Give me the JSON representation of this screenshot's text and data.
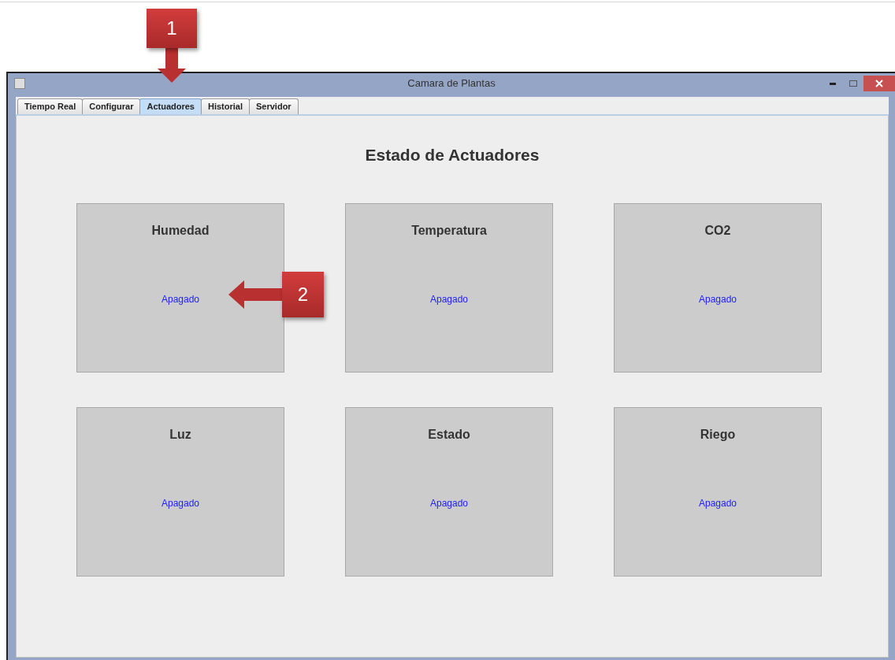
{
  "window": {
    "title": "Camara de Plantas"
  },
  "tabs": [
    {
      "label": "Tiempo Real",
      "selected": false
    },
    {
      "label": "Configurar",
      "selected": false
    },
    {
      "label": "Actuadores",
      "selected": true
    },
    {
      "label": "Historial",
      "selected": false
    },
    {
      "label": "Servidor",
      "selected": false
    }
  ],
  "heading": "Estado de Actuadores",
  "panels": [
    {
      "title": "Humedad",
      "status": "Apagado"
    },
    {
      "title": "Temperatura",
      "status": "Apagado"
    },
    {
      "title": "CO2",
      "status": "Apagado"
    },
    {
      "title": "Luz",
      "status": "Apagado"
    },
    {
      "title": "Estado",
      "status": "Apagado"
    },
    {
      "title": "Riego",
      "status": "Apagado"
    }
  ],
  "callouts": [
    {
      "label": "1",
      "kind": "down"
    },
    {
      "label": "2",
      "kind": "left"
    }
  ]
}
